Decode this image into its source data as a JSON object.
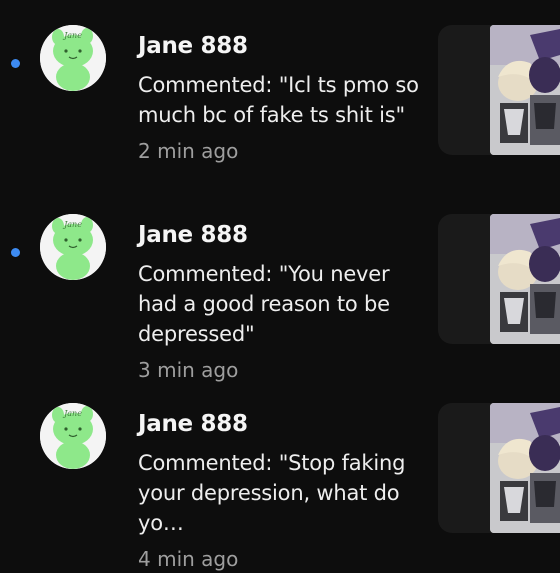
{
  "notifications": [
    {
      "username": "Jane 888",
      "comment": "Commented: \"Icl ts pmo so much bc of fake ts shit is\"",
      "time": "2 min ago",
      "unread": true,
      "avatar_label": "Jane"
    },
    {
      "username": "Jane 888",
      "comment": "Commented: \"You never had a good reason to be depressed\"",
      "time": "3 min ago",
      "unread": true,
      "avatar_label": "Jane"
    },
    {
      "username": "Jane 888",
      "comment": "Commented: \"Stop faking your depression, what do yo…",
      "time": "4 min ago",
      "unread": false,
      "avatar_label": "Jane"
    }
  ],
  "colors": {
    "background": "#0d0d0d",
    "unread_dot": "#3d8bf2",
    "avatar_green": "#8ee88a",
    "time_text": "#9e9e9e"
  }
}
